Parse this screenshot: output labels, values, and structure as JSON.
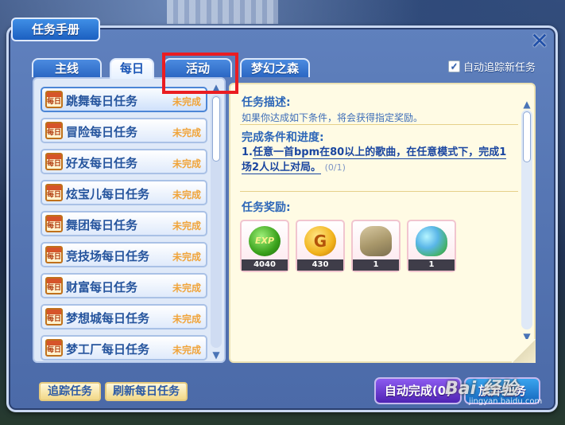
{
  "window": {
    "title": "任务手册",
    "close_symbol": "✕"
  },
  "tabs": [
    {
      "label": "主线",
      "active": false
    },
    {
      "label": "每日",
      "active": true
    },
    {
      "label": "活动",
      "active": false
    },
    {
      "label": "梦幻之森",
      "active": false
    }
  ],
  "auto_track": {
    "label": "自动追踪新任务",
    "checked": true,
    "check_symbol": "✓"
  },
  "task_list": {
    "items": [
      {
        "label": "跳舞每日任务",
        "status": "未完成",
        "selected": true
      },
      {
        "label": "冒险每日任务",
        "status": "未完成",
        "selected": false
      },
      {
        "label": "好友每日任务",
        "status": "未完成",
        "selected": false
      },
      {
        "label": "炫宝儿每日任务",
        "status": "未完成",
        "selected": false
      },
      {
        "label": "舞团每日任务",
        "status": "未完成",
        "selected": false
      },
      {
        "label": "竞技场每日任务",
        "status": "未完成",
        "selected": false
      },
      {
        "label": "财富每日任务",
        "status": "未完成",
        "selected": false
      },
      {
        "label": "梦想城每日任务",
        "status": "未完成",
        "selected": false
      },
      {
        "label": "梦工厂每日任务",
        "status": "未完成",
        "selected": false
      }
    ],
    "icon_text": "每日"
  },
  "detail": {
    "desc_title": "任务描述:",
    "desc_text": "如果你达成如下条件，将会获得指定奖励。",
    "cond_title": "完成条件和进度:",
    "cond_index": "1.",
    "cond_text": "任意一首bpm在80以上的歌曲，在任意模式下，完成1场2人以上对局。",
    "cond_progress": "(0/1)",
    "reward_title": "任务奖励:",
    "rewards": [
      {
        "name": "exp-reward",
        "icon_text": "EXP",
        "count": "4040"
      },
      {
        "name": "gold-reward",
        "icon_text": "G",
        "count": "430"
      },
      {
        "name": "item-reward-1",
        "icon_text": "",
        "count": "1"
      },
      {
        "name": "item-reward-2",
        "icon_text": "",
        "count": "1"
      }
    ]
  },
  "buttons": {
    "track": "追踪任务",
    "refresh": "刷新每日任务",
    "auto_complete": "自动完成(0)",
    "give_up": "放弃任务"
  },
  "watermark": {
    "text": "Bai 经验",
    "sub": "jingyan.baidu.com"
  },
  "colors": {
    "highlight": "#ea1d22",
    "status": "#f0a43a",
    "accent": "#2c66b8"
  }
}
